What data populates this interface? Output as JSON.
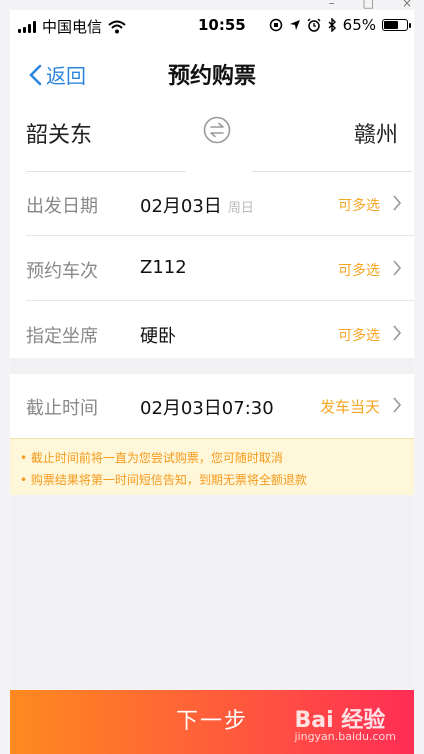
{
  "window": {
    "minimize": "–",
    "maximize": "□",
    "close": "×"
  },
  "statusbar": {
    "carrier": "中国电信",
    "time": "10:55",
    "battery": "65%",
    "battery_level": 0.65
  },
  "nav": {
    "back_label": "返回",
    "title": "预约购票"
  },
  "route": {
    "from": "韶关东",
    "to": "赣州"
  },
  "rows": [
    {
      "label": "出发日期",
      "value": "02月03日",
      "sub": "周日",
      "option": "可多选"
    },
    {
      "label": "预约车次",
      "value": "Z112",
      "option": "可多选"
    },
    {
      "label": "指定坐席",
      "value": "硬卧",
      "option": "可多选"
    }
  ],
  "deadline": {
    "label": "截止时间",
    "value": "02月03日07:30",
    "option": "发车当天"
  },
  "notices": [
    "• 截止时间前将一直为您尝试购票，您可随时取消",
    "• 购票结果将第一时间短信告知，到期无票将全额退款"
  ],
  "next_button": "下一步",
  "watermark": {
    "brand": "Bai 经验",
    "url": "jingyan.baidu.com"
  },
  "colors": {
    "accent": "#2e86de",
    "option": "#f5a623",
    "notice": "#f59a1d"
  }
}
